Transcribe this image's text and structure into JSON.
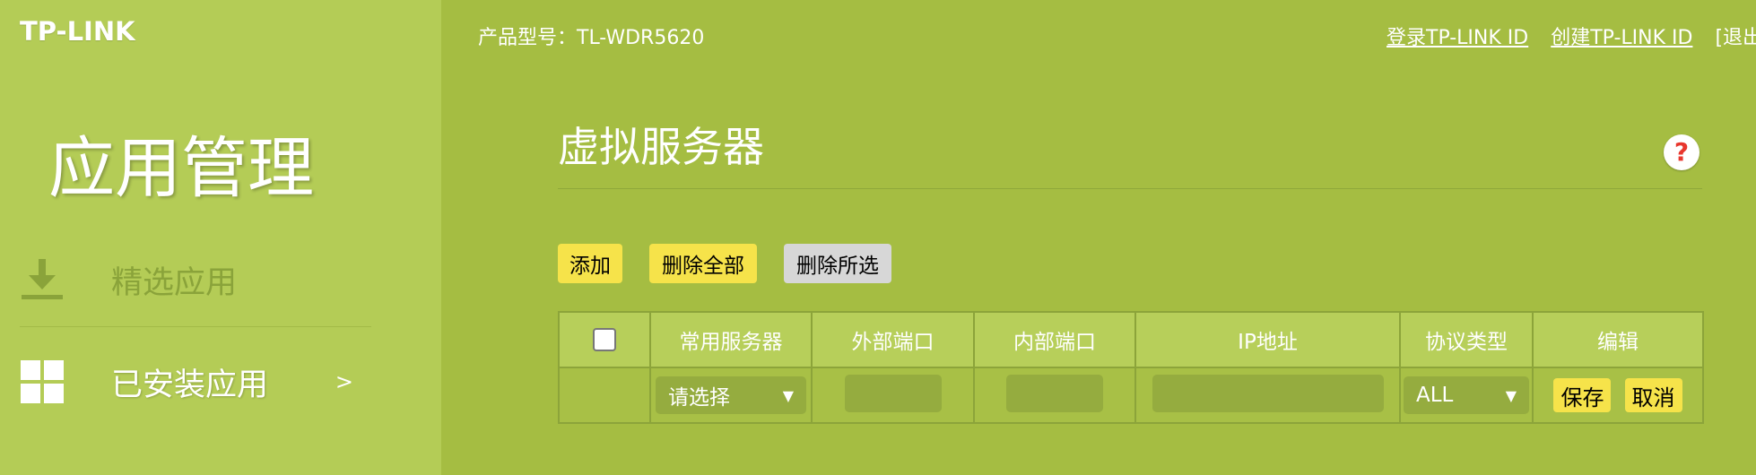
{
  "brand": {
    "logo_text": "TP-LINK"
  },
  "sidebar": {
    "title": "应用管理",
    "items": [
      {
        "label": "精选应用",
        "icon": "download-icon"
      },
      {
        "label": "已安装应用",
        "icon": "grid-icon",
        "chevron": ">"
      }
    ]
  },
  "header": {
    "model_label": "产品型号：TL-WDR5620",
    "links": {
      "login": "登录TP-LINK ID",
      "create": "创建TP-LINK ID",
      "logout": "[退出"
    }
  },
  "main": {
    "title": "虚拟服务器",
    "help_symbol": "?",
    "buttons": {
      "add": "添加",
      "delete_all": "删除全部",
      "delete_selected": "删除所选"
    },
    "table": {
      "columns": [
        "常用服务器",
        "外部端口",
        "内部端口",
        "IP地址",
        "协议类型",
        "编辑"
      ],
      "row": {
        "common_server_value": "请选择",
        "external_port_value": "",
        "internal_port_value": "",
        "ip_value": "",
        "protocol_value": "ALL",
        "save_label": "保存",
        "cancel_label": "取消"
      }
    }
  },
  "colors": {
    "background": "#a5bd42",
    "sidebar": "#b4cc56",
    "button_primary": "#f6e34a",
    "button_disabled": "#d7d7d7",
    "help_icon": "#e8362d"
  }
}
